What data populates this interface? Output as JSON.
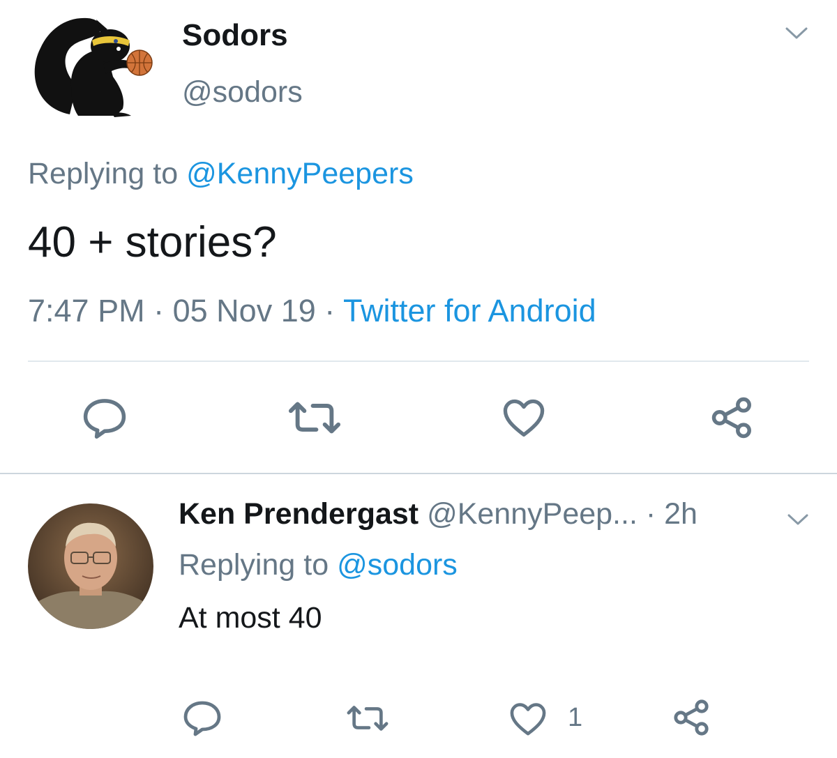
{
  "main_tweet": {
    "display_name": "Sodors",
    "handle": "@sodors",
    "replying_prefix": "Replying to",
    "replying_to": "@KennyPeepers",
    "text": "40 + stories?",
    "time": "7:47 PM",
    "date": "05 Nov 19",
    "separator": "·",
    "source": "Twitter for Android",
    "actions": {
      "reply": "reply-icon",
      "retweet": "retweet-icon",
      "like": "heart-icon",
      "share": "share-icon"
    }
  },
  "reply_tweet": {
    "display_name": "Ken Prendergast",
    "handle": "@KennyPeep...",
    "time_prefix": "·",
    "relative_time": "2h",
    "replying_prefix": "Replying to",
    "replying_to": "@sodors",
    "text": "At most 40",
    "like_count": "1"
  },
  "colors": {
    "link": "#1b95e0",
    "muted": "#657786",
    "text": "#14171a",
    "divider": "#e1e8ed",
    "basketball": "#d2743a"
  }
}
